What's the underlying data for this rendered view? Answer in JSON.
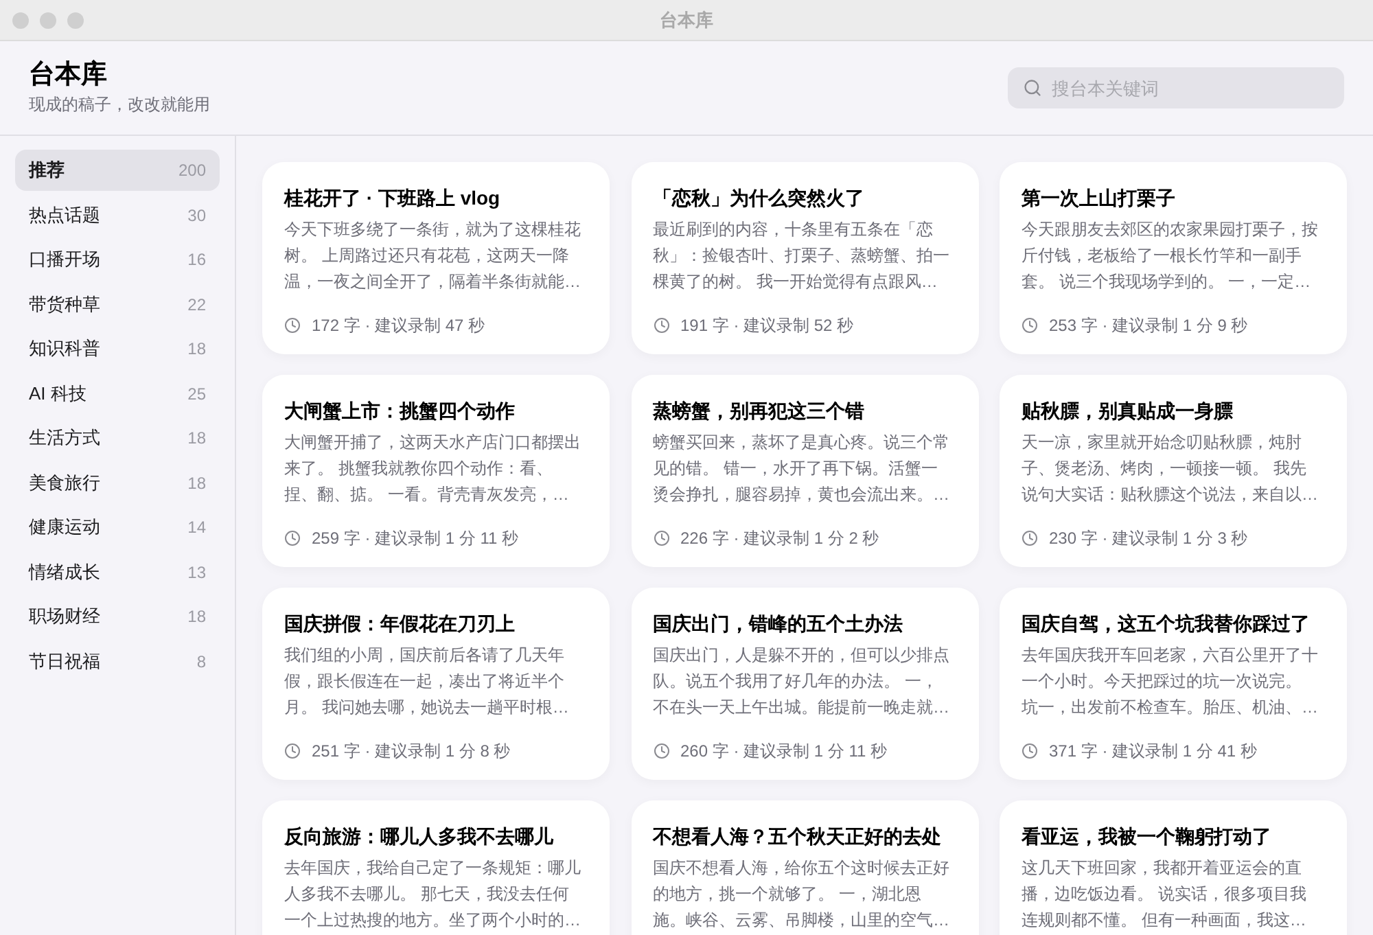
{
  "window": {
    "title": "台本库"
  },
  "header": {
    "title": "台本库",
    "subtitle": "现成的稿子，改改就能用",
    "search": {
      "placeholder": "搜台本关键词"
    }
  },
  "sidebar": {
    "items": [
      {
        "label": "推荐",
        "count": "200",
        "selected": true
      },
      {
        "label": "热点话题",
        "count": "30",
        "selected": false
      },
      {
        "label": "口播开场",
        "count": "16",
        "selected": false
      },
      {
        "label": "带货种草",
        "count": "22",
        "selected": false
      },
      {
        "label": "知识科普",
        "count": "18",
        "selected": false
      },
      {
        "label": "AI 科技",
        "count": "25",
        "selected": false
      },
      {
        "label": "生活方式",
        "count": "18",
        "selected": false
      },
      {
        "label": "美食旅行",
        "count": "18",
        "selected": false
      },
      {
        "label": "健康运动",
        "count": "14",
        "selected": false
      },
      {
        "label": "情绪成长",
        "count": "13",
        "selected": false
      },
      {
        "label": "职场财经",
        "count": "18",
        "selected": false
      },
      {
        "label": "节日祝福",
        "count": "8",
        "selected": false
      }
    ]
  },
  "cards": [
    {
      "title": "桂花开了 · 下班路上 vlog",
      "excerpt": [
        "今天下班多绕了一条街，就为了这棵桂花",
        "树。 上周路过还只有花苞，这两天一降",
        "温，一夜之间全开了，隔着半条街就能…"
      ],
      "meta": "172 字 · 建议录制 47 秒"
    },
    {
      "title": "「恋秋」为什么突然火了",
      "excerpt": [
        "最近刷到的内容，十条里有五条在「恋",
        "秋」：捡银杏叶、打栗子、蒸螃蟹、拍一",
        "棵黄了的树。 我一开始觉得有点跟风…"
      ],
      "meta": "191 字 · 建议录制 52 秒"
    },
    {
      "title": "第一次上山打栗子",
      "excerpt": [
        "今天跟朋友去郊区的农家果园打栗子，按",
        "斤付钱，老板给了一根长竹竿和一副手",
        "套。 说三个我现场学到的。 一，一定…"
      ],
      "meta": "253 字 · 建议录制 1 分 9 秒"
    },
    {
      "title": "大闸蟹上市：挑蟹四个动作",
      "excerpt": [
        "大闸蟹开捕了，这两天水产店门口都摆出",
        "来了。 挑蟹我就教你四个动作：看、",
        "捏、翻、掂。 一看。背壳青灰发亮，…"
      ],
      "meta": "259 字 · 建议录制 1 分 11 秒"
    },
    {
      "title": "蒸螃蟹，别再犯这三个错",
      "excerpt": [
        "螃蟹买回来，蒸坏了是真心疼。说三个常",
        "见的错。 错一，水开了再下锅。活蟹一",
        "烫会挣扎，腿容易掉，黄也会流出来。…"
      ],
      "meta": "226 字 · 建议录制 1 分 2 秒"
    },
    {
      "title": "贴秋膘，别真贴成一身膘",
      "excerpt": [
        "天一凉，家里就开始念叨贴秋膘，炖肘",
        "子、煲老汤、烤肉，一顿接一顿。 我先",
        "说句大实话：贴秋膘这个说法，来自以…"
      ],
      "meta": "230 字 · 建议录制 1 分 3 秒"
    },
    {
      "title": "国庆拼假：年假花在刀刃上",
      "excerpt": [
        "我们组的小周，国庆前后各请了几天年",
        "假，跟长假连在一起，凑出了将近半个",
        "月。 我问她去哪，她说去一趟平时根…"
      ],
      "meta": "251 字 · 建议录制 1 分 8 秒"
    },
    {
      "title": "国庆出门，错峰的五个土办法",
      "excerpt": [
        "国庆出门，人是躲不开的，但可以少排点",
        "队。说五个我用了好几年的办法。 一，",
        "不在头一天上午出城。能提前一晚走就…"
      ],
      "meta": "260 字 · 建议录制 1 分 11 秒"
    },
    {
      "title": "国庆自驾，这五个坑我替你踩过了",
      "excerpt": [
        "去年国庆我开车回老家，六百公里开了十",
        "一个小时。今天把踩过的坑一次说完。",
        "坑一，出发前不检查车。胎压、机油、…"
      ],
      "meta": "371 字 · 建议录制 1 分 41 秒"
    },
    {
      "title": "反向旅游：哪儿人多我不去哪儿",
      "excerpt": [
        "去年国庆，我给自己定了一条规矩：哪儿",
        "人多我不去哪儿。 那七天，我没去任何",
        "一个上过热搜的地方。坐了两个小时的…"
      ]
    },
    {
      "title": "不想看人海？五个秋天正好的去处",
      "excerpt": [
        "国庆不想看人海，给你五个这时候去正好",
        "的地方，挑一个就够了。 一，湖北恩",
        "施。峡谷、云雾、吊脚楼，山里的空气…"
      ]
    },
    {
      "title": "看亚运，我被一个鞠躬打动了",
      "excerpt": [
        "这几天下班回家，我都开着亚运会的直",
        "播，边吃饭边看。 说实话，很多项目我",
        "连规则都不懂。 但有一种画面，我这…"
      ]
    }
  ]
}
